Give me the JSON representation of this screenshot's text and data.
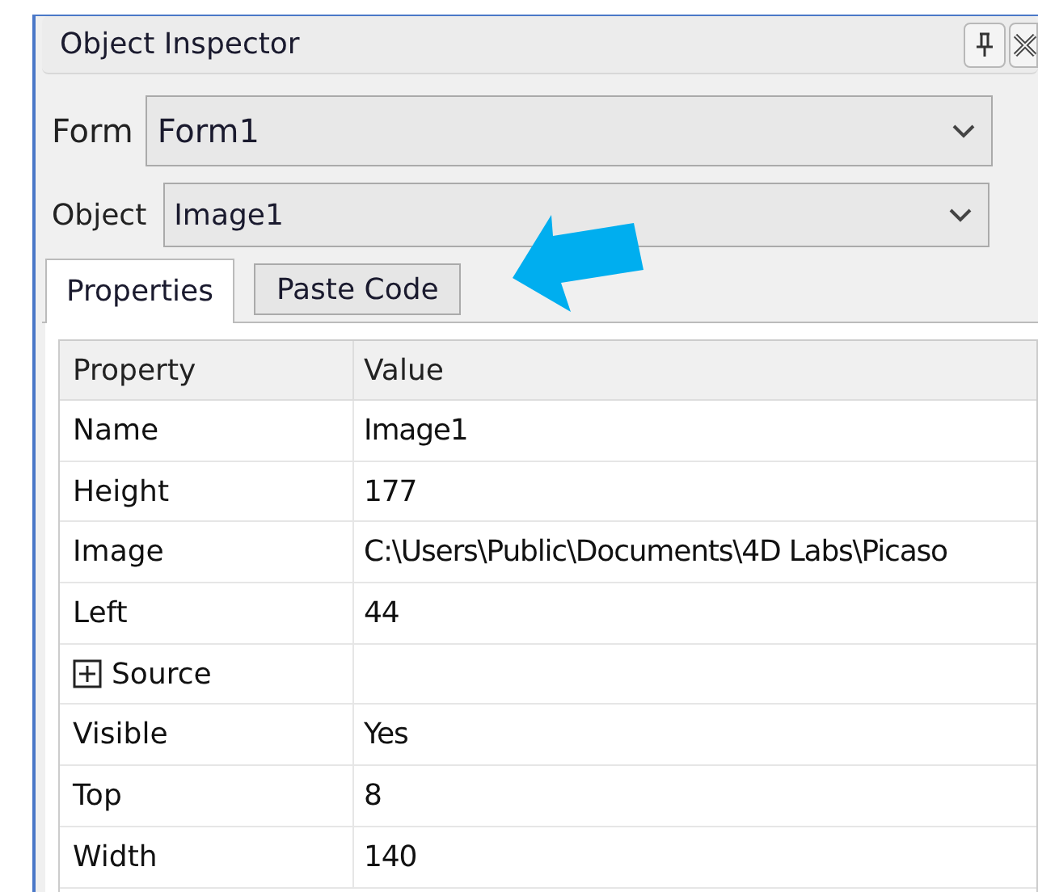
{
  "panel": {
    "title": "Object Inspector"
  },
  "form_select": {
    "label": "Form",
    "value": "Form1"
  },
  "object_select": {
    "label": "Object",
    "value": "Image1"
  },
  "tabs": [
    {
      "label": "Properties",
      "selected": true
    },
    {
      "label": "Paste Code",
      "selected": false
    }
  ],
  "table": {
    "columns": [
      "Property",
      "Value"
    ],
    "rows": [
      {
        "property": "Name",
        "value": "Image1"
      },
      {
        "property": "Height",
        "value": "177"
      },
      {
        "property": "Image",
        "value": "C:\\Users\\Public\\Documents\\4D Labs\\Picaso"
      },
      {
        "property": "Left",
        "value": "44"
      },
      {
        "property": "Source",
        "value": "",
        "expanded": false
      },
      {
        "property": "Visible",
        "value": "Yes"
      },
      {
        "property": "Top",
        "value": "8"
      },
      {
        "property": "Width",
        "value": "140"
      }
    ]
  }
}
